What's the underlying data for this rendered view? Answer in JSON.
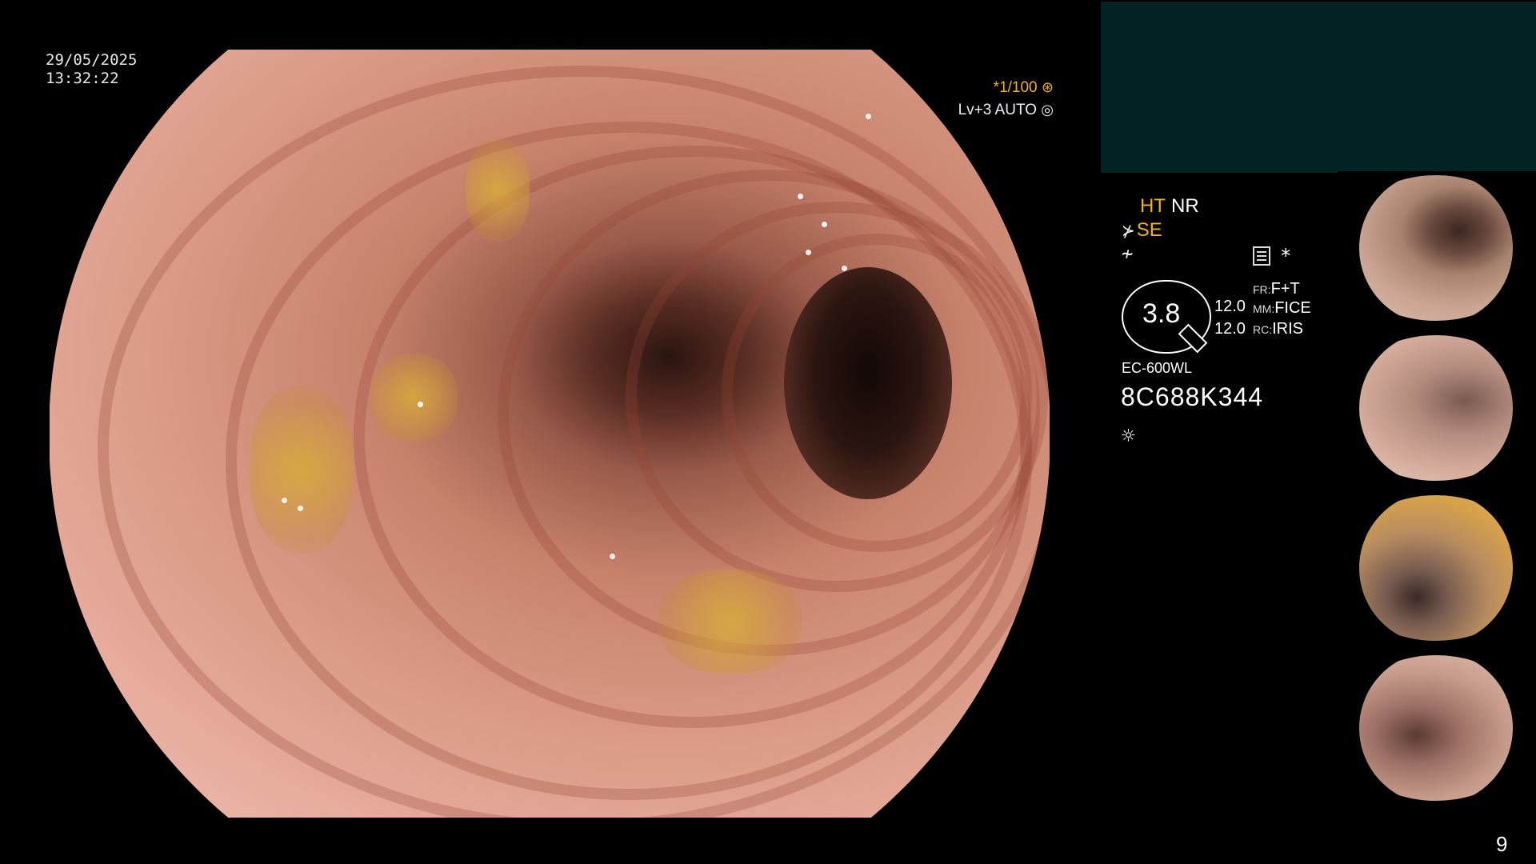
{
  "overlay": {
    "date": "29/05/2025",
    "time": "13:32:22",
    "shutter": "*1/100",
    "shutter_icon": "aperture-icon",
    "light_level": "Lv+3 AUTO",
    "light_level_icon": "auto-iris-icon"
  },
  "panel": {
    "ht_label": "HT",
    "nr_label": "NR",
    "se_label": "SE",
    "gauge_value": "3.8",
    "gauge_value_1": "12.0",
    "gauge_value_2": "12.0",
    "fr_key": "FR:",
    "fr_value": "F+T",
    "mm_key": "MM:",
    "mm_value": "FICE",
    "rc_key": "RC:",
    "rc_value": "IRIS",
    "scope_model": "EC-600WL",
    "scope_serial": "8C688K344",
    "asterisk": "*"
  },
  "page_number": "9",
  "colors": {
    "accent_yellow": "#f5b400",
    "panel_bg": "#022223"
  }
}
